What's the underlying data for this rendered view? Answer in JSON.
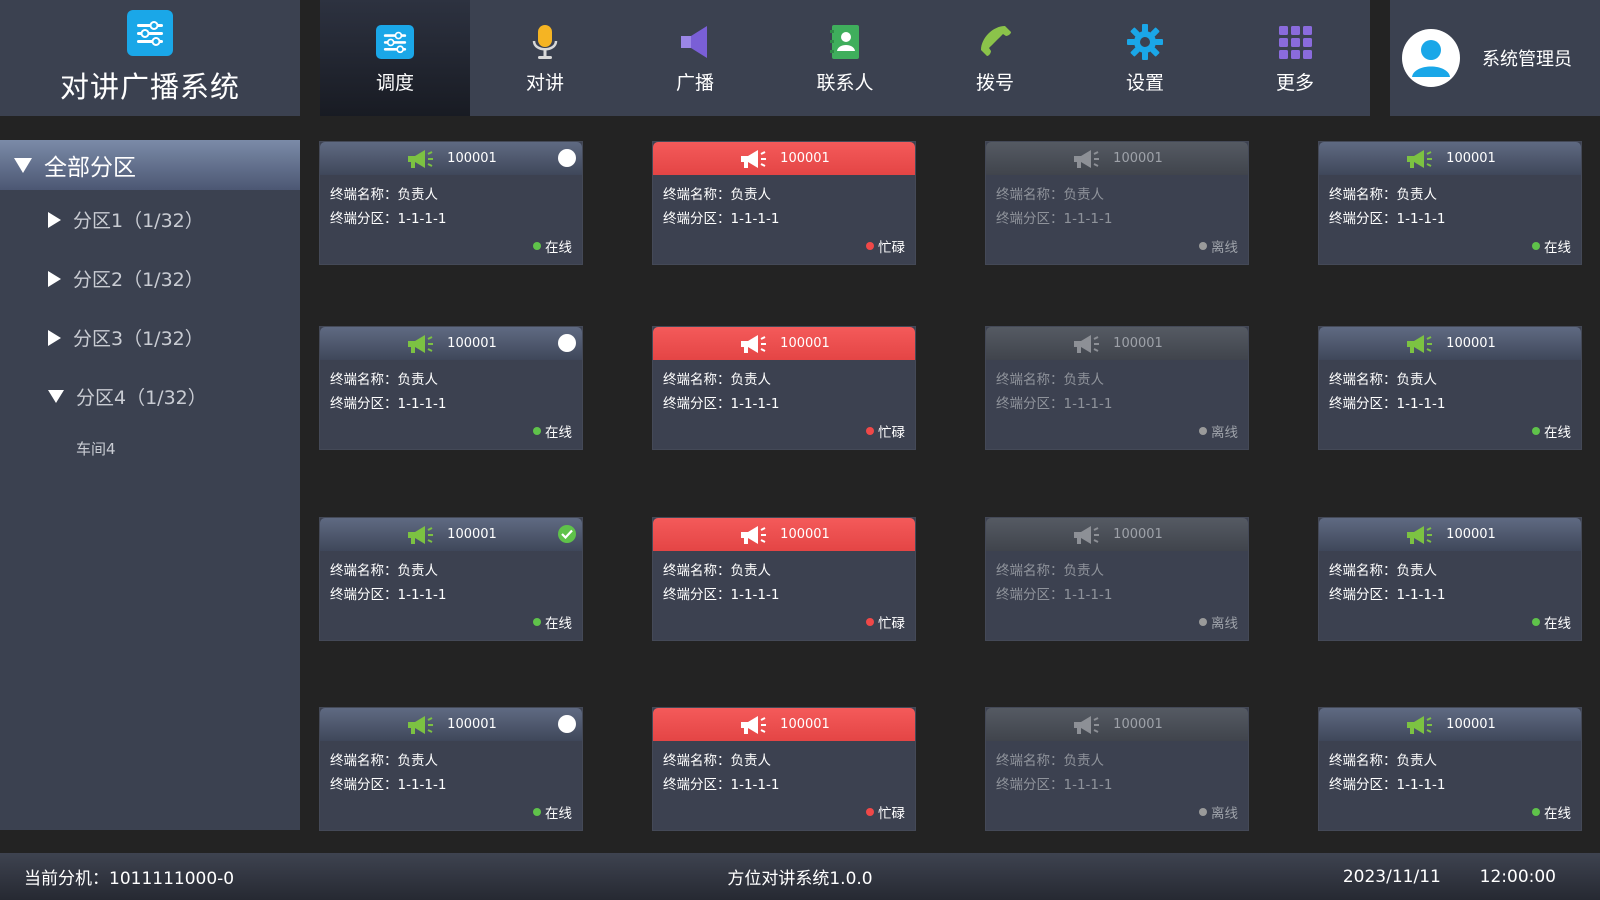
{
  "app": {
    "title": "对讲广播系统",
    "brand_icon": "sliders-icon",
    "brand_color": "#1aa7e8"
  },
  "nav": [
    {
      "label": "调度",
      "icon": "sliders-icon",
      "color": "#1aa7e8",
      "active": true
    },
    {
      "label": "对讲",
      "icon": "microphone-icon",
      "color": "#f5b423",
      "active": false
    },
    {
      "label": "广播",
      "icon": "speaker-icon",
      "color": "#7a5fd6",
      "active": false
    },
    {
      "label": "联系人",
      "icon": "contacts-icon",
      "color": "#3fae5c",
      "active": false
    },
    {
      "label": "拨号",
      "icon": "phone-icon",
      "color": "#8bc34a",
      "active": false
    },
    {
      "label": "设置",
      "icon": "gear-icon",
      "color": "#1aa7e8",
      "active": false
    },
    {
      "label": "更多",
      "icon": "grid-icon",
      "color": "#8a6bdc",
      "active": false
    }
  ],
  "user": {
    "name": "系统管理员",
    "avatar_color": "#1aa7e8"
  },
  "sidebar": {
    "header": "全部分区",
    "items": [
      {
        "label": "分区1（1/32）",
        "expanded": false
      },
      {
        "label": "分区2（1/32）",
        "expanded": false
      },
      {
        "label": "分区3（1/32）",
        "expanded": false
      },
      {
        "label": "分区4（1/32）",
        "expanded": true
      }
    ],
    "sub_items": [
      "车间4"
    ]
  },
  "cards": [
    {
      "id": "100001",
      "name_label": "终端名称：负责人",
      "zone_label": "终端分区：1-1-1-1",
      "status": "online",
      "status_text": "在线",
      "selector": "dot"
    },
    {
      "id": "100001",
      "name_label": "终端名称：负责人",
      "zone_label": "终端分区：1-1-1-1",
      "status": "busy",
      "status_text": "忙碌",
      "selector": "none"
    },
    {
      "id": "100001",
      "name_label": "终端名称：负责人",
      "zone_label": "终端分区：1-1-1-1",
      "status": "offline",
      "status_text": "离线",
      "selector": "none"
    },
    {
      "id": "100001",
      "name_label": "终端名称：负责人",
      "zone_label": "终端分区：1-1-1-1",
      "status": "online",
      "status_text": "在线",
      "selector": "none"
    },
    {
      "id": "100001",
      "name_label": "终端名称：负责人",
      "zone_label": "终端分区：1-1-1-1",
      "status": "online",
      "status_text": "在线",
      "selector": "dot"
    },
    {
      "id": "100001",
      "name_label": "终端名称：负责人",
      "zone_label": "终端分区：1-1-1-1",
      "status": "busy",
      "status_text": "忙碌",
      "selector": "none"
    },
    {
      "id": "100001",
      "name_label": "终端名称：负责人",
      "zone_label": "终端分区：1-1-1-1",
      "status": "offline",
      "status_text": "离线",
      "selector": "none"
    },
    {
      "id": "100001",
      "name_label": "终端名称：负责人",
      "zone_label": "终端分区：1-1-1-1",
      "status": "online",
      "status_text": "在线",
      "selector": "none"
    },
    {
      "id": "100001",
      "name_label": "终端名称：负责人",
      "zone_label": "终端分区：1-1-1-1",
      "status": "online",
      "status_text": "在线",
      "selector": "check"
    },
    {
      "id": "100001",
      "name_label": "终端名称：负责人",
      "zone_label": "终端分区：1-1-1-1",
      "status": "busy",
      "status_text": "忙碌",
      "selector": "none"
    },
    {
      "id": "100001",
      "name_label": "终端名称：负责人",
      "zone_label": "终端分区：1-1-1-1",
      "status": "offline",
      "status_text": "离线",
      "selector": "none"
    },
    {
      "id": "100001",
      "name_label": "终端名称：负责人",
      "zone_label": "终端分区：1-1-1-1",
      "status": "online",
      "status_text": "在线",
      "selector": "none"
    },
    {
      "id": "100001",
      "name_label": "终端名称：负责人",
      "zone_label": "终端分区：1-1-1-1",
      "status": "online",
      "status_text": "在线",
      "selector": "dot"
    },
    {
      "id": "100001",
      "name_label": "终端名称：负责人",
      "zone_label": "终端分区：1-1-1-1",
      "status": "busy",
      "status_text": "忙碌",
      "selector": "none"
    },
    {
      "id": "100001",
      "name_label": "终端名称：负责人",
      "zone_label": "终端分区：1-1-1-1",
      "status": "offline",
      "status_text": "离线",
      "selector": "none"
    },
    {
      "id": "100001",
      "name_label": "终端名称：负责人",
      "zone_label": "终端分区：1-1-1-1",
      "status": "online",
      "status_text": "在线",
      "selector": "none"
    }
  ],
  "status_colors": {
    "online": "#5fc24a",
    "busy": "#f04848",
    "offline": "#9a9a9a",
    "online_icon": "#7cc242",
    "offline_icon": "#8d9096"
  },
  "footer": {
    "current_extension": "当前分机：1011111000-0",
    "version": "方位对讲系统1.0.0",
    "date": "2023/11/11",
    "time": "12:00:00"
  }
}
